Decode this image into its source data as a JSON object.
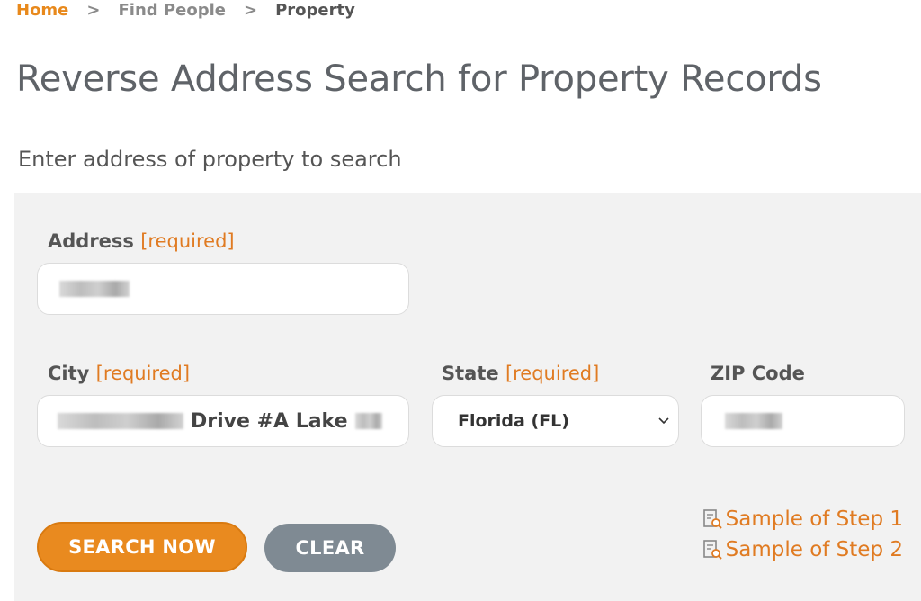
{
  "breadcrumb": {
    "home": "Home",
    "separator": ">",
    "find_people": "Find People",
    "current": "Property"
  },
  "page_title": "Reverse Address Search for Property Records",
  "subtitle": "Enter address of property to search",
  "form": {
    "address": {
      "label": "Address",
      "required_tag": "[required]",
      "value": ""
    },
    "city": {
      "label": "City",
      "required_tag": "[required]",
      "visible_value": "Drive #A Lake"
    },
    "state": {
      "label": "State",
      "required_tag": "[required]",
      "selected": "Florida (FL)"
    },
    "zip": {
      "label": "ZIP Code",
      "value": ""
    }
  },
  "buttons": {
    "search": "SEARCH NOW",
    "clear": "CLEAR"
  },
  "samples": [
    {
      "label": "Sample of Step 1",
      "icon": "document-search-icon"
    },
    {
      "label": "Sample of Step 2",
      "icon": "document-search-icon"
    }
  ],
  "colors": {
    "accent": "#e98a1f",
    "clear_button": "#7f8a93",
    "panel_bg": "#f2f2f2"
  }
}
